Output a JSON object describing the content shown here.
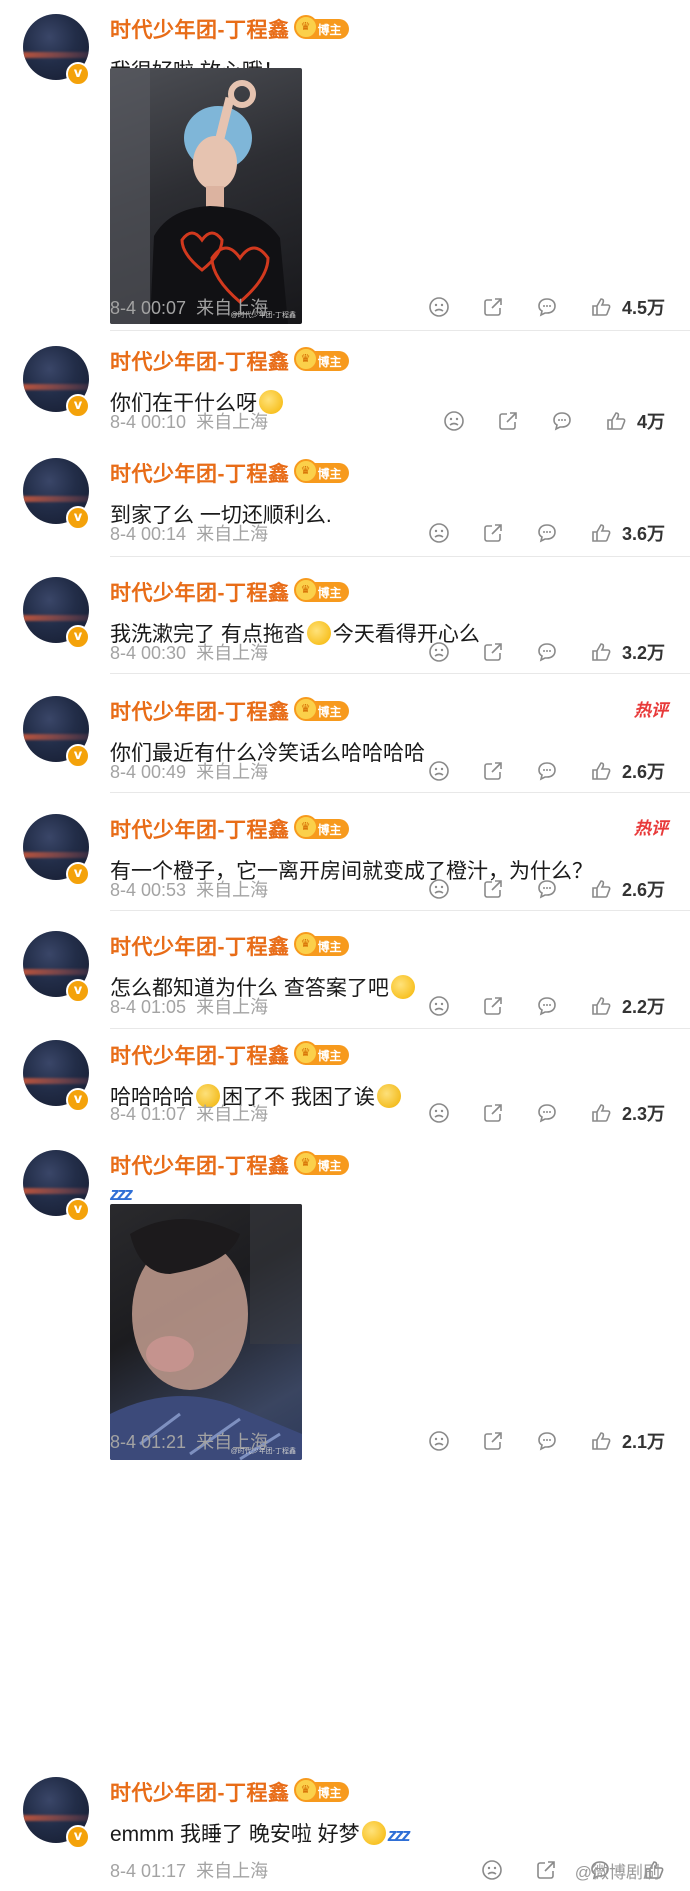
{
  "author": {
    "name": "时代少年团-丁程鑫",
    "badge": "博主",
    "verified_icon": "v"
  },
  "comments": [
    {
      "text": "我很好啦 放心哦！",
      "time": "8-4 00:07",
      "location": "来自上海",
      "likes": "4.5万",
      "photo": "photo-selfie-blue-hair",
      "hot": ""
    },
    {
      "text": "你们在干什么呀",
      "emoji": [
        "laugh-emoji"
      ],
      "time": "8-4 00:10",
      "location": "来自上海",
      "likes": "4万",
      "hot": ""
    },
    {
      "text": "到家了么 一切还顺利么.",
      "time": "8-4 00:14",
      "location": "来自上海",
      "likes": "3.6万",
      "hot": ""
    },
    {
      "text_a": "我洗漱完了 有点拖沓",
      "text_b": "今天看得开心么",
      "emoji": [
        "laugh-emoji"
      ],
      "time": "8-4 00:30",
      "location": "来自上海",
      "likes": "3.2万",
      "hot": ""
    },
    {
      "text": "你们最近有什么冷笑话么哈哈哈哈",
      "time": "8-4 00:49",
      "location": "来自上海",
      "likes": "2.6万",
      "hot": "热评"
    },
    {
      "text": "有一个橙子，它一离开房间就变成了橙汁，为什么？",
      "time": "8-4 00:53",
      "location": "来自上海",
      "likes": "2.6万",
      "hot": "热评"
    },
    {
      "text": "怎么都知道为什么 查答案了吧",
      "emoji": [
        "thinking-emoji"
      ],
      "time": "8-4 01:05",
      "location": "来自上海",
      "likes": "2.2万",
      "hot": ""
    },
    {
      "text_a": "哈哈哈哈",
      "text_b": "困了不 我困了诶",
      "emoji": [
        "cry-laugh-emoji"
      ],
      "time": "8-4 01:07",
      "location": "来自上海",
      "likes": "2.3万",
      "hot": ""
    },
    {
      "text": "zzz",
      "time": "8-4 01:21",
      "location": "来自上海",
      "likes": "2.1万",
      "photo": "photo-sleepy-face",
      "hot": ""
    },
    {
      "text_a": "emmm 我睡了 晚安啦 好梦",
      "text_b": "zzz",
      "emoji": [
        "thinking-emoji"
      ],
      "time": "8-4 01:17",
      "location": "来自上海",
      "likes": "",
      "hot": ""
    }
  ],
  "watermark": "@微博剧刷",
  "photo_watermark": "@时代少年团-丁程鑫",
  "colors": {
    "name": "#e86c17",
    "badge": "#f79a1d",
    "hot": "#e83a3a",
    "meta": "#a3a3a3"
  }
}
